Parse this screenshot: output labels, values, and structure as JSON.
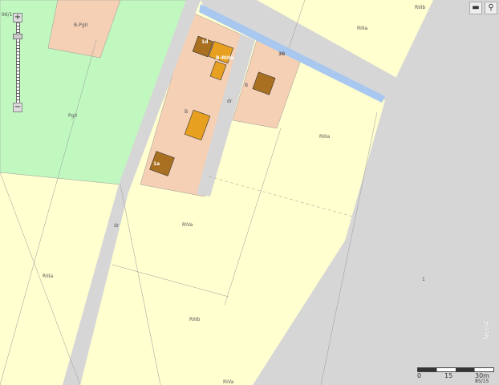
{
  "colors": {
    "arable": "#ffffd0",
    "grassland": "#c0f8c0",
    "built_parcel": "#f5d0b5",
    "road": "#d6d6d6",
    "water": "#a8c8f0",
    "building": "#e8a020",
    "building_dark": "#a87020"
  },
  "map": {
    "labels": {
      "parcel_top": "B-PgII",
      "grass": "PgII",
      "b1": "B",
      "b2": "B",
      "road_dr1": "dr",
      "road_dr2": "dr",
      "bldg_1a": "1a",
      "bldg_1d": "1d",
      "bldg_mix": "B-RIIIa",
      "house_num": "36",
      "riiia_top": "RIIIa",
      "riiib_top": "RIIIb",
      "riiia_mid": "RIIIa",
      "riva": "RIVa",
      "riiia_left": "RIIIa",
      "riiib_bottom": "RIIIb",
      "rivb_bottom": "RIVa",
      "gray_1": "1",
      "corner": "96/1"
    }
  },
  "zoom": {
    "in": "+",
    "out": "−",
    "level_fraction": 0.14
  },
  "tools": {
    "comment_icon": "speech-bubble-icon",
    "search_icon": "search-icon"
  },
  "scale": {
    "t0": "0",
    "t1": "15",
    "t2": "30m",
    "sub": "85/15"
  },
  "logo": "Neo4"
}
